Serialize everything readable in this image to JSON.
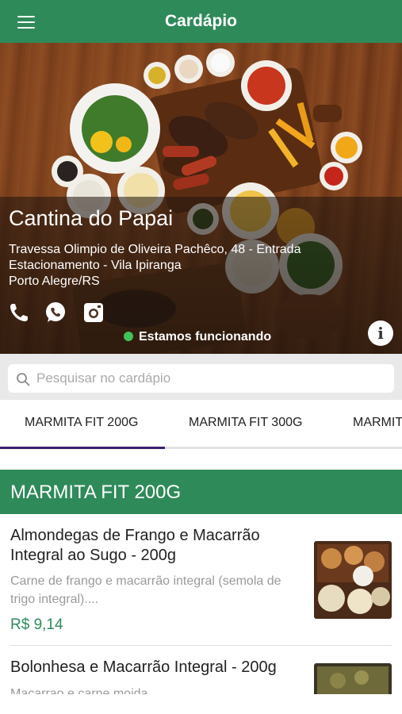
{
  "header": {
    "title": "Cardápio",
    "menu_icon": "hamburger-menu-icon"
  },
  "restaurant": {
    "name": "Cantina do Papai",
    "address_line1": "Travessa Olimpio de Oliveira Pachêco, 48 - Entrada",
    "address_line2": "Estacionamento - Vila Ipiranga",
    "address_line3": "Porto Alegre/RS",
    "status": "Estamos funcionando",
    "status_color": "#43c258",
    "info_icon": "i"
  },
  "search": {
    "placeholder": "Pesquisar no cardápio",
    "value": ""
  },
  "tabs": [
    {
      "label": "MARMITA FIT 200G",
      "active": true
    },
    {
      "label": "MARMITA FIT 300G",
      "active": false
    },
    {
      "label": "MARMITA",
      "active": false
    }
  ],
  "section": {
    "title": "MARMITA FIT 200G"
  },
  "items": [
    {
      "name_line1": "Almondegas de Frango e Macarrão",
      "name_line2": "Integral ao Sugo - 200g",
      "desc_line1": "Carne de frango e macarrão integral (semola de",
      "desc_line2": "trigo integral)....",
      "price": "R$ 9,14"
    },
    {
      "name_line1": "Bolonhesa e Macarrão Integral   - 200g",
      "desc_line1": "Macarrao e carne moida"
    }
  ],
  "colors": {
    "brand": "#2f8a5a",
    "tab_indicator": "#3d1f6e",
    "price": "#2f8a5a"
  }
}
